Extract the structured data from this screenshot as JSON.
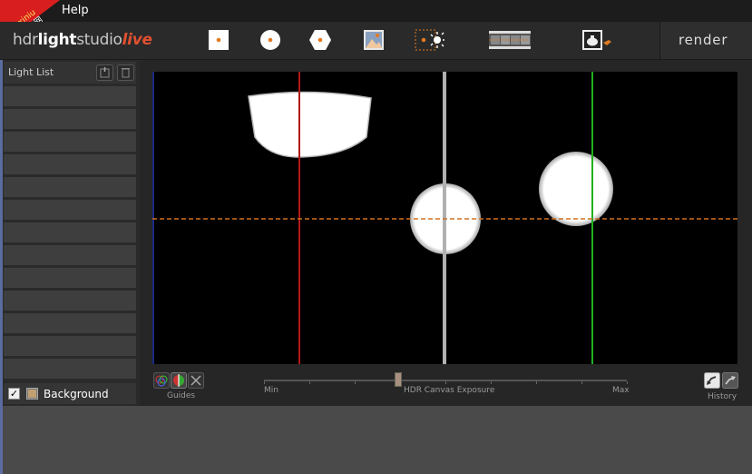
{
  "menubar": {
    "help": "Help",
    "watermark": {
      "line1": "xuexiniu",
      "line2": "学犀牛中文网"
    }
  },
  "toolbar": {
    "logo": {
      "part1": "hdr",
      "part2": "light",
      "part3": "studio",
      "part4": "live"
    },
    "tools": [
      {
        "icon": "point-light-square-icon"
      },
      {
        "icon": "point-light-circle-icon"
      },
      {
        "icon": "point-light-hexagon-icon"
      },
      {
        "icon": "image-light-icon"
      },
      {
        "icon": "sun-light-icon"
      },
      {
        "icon": "filmstrip-icon"
      },
      {
        "icon": "teapot-render-icon"
      }
    ],
    "render_label": "render"
  },
  "light_list": {
    "title": "Light List",
    "slot_count": 13,
    "background_row": {
      "checked": true,
      "label": "Background"
    }
  },
  "canvas": {
    "guides": {
      "vertical_red": "#b01818",
      "vertical_gray": "#b0b0b0",
      "vertical_green": "#20b020",
      "horizontal_orange_dashed": "#d07020"
    }
  },
  "controls": {
    "guides_label": "Guides",
    "exposure": {
      "min_label": "Min",
      "title": "HDR Canvas Exposure",
      "max_label": "Max",
      "value": 0.37
    },
    "history_label": "History"
  },
  "colors": {
    "accent_orange": "#e07a20",
    "logo_live": "#e05030"
  }
}
